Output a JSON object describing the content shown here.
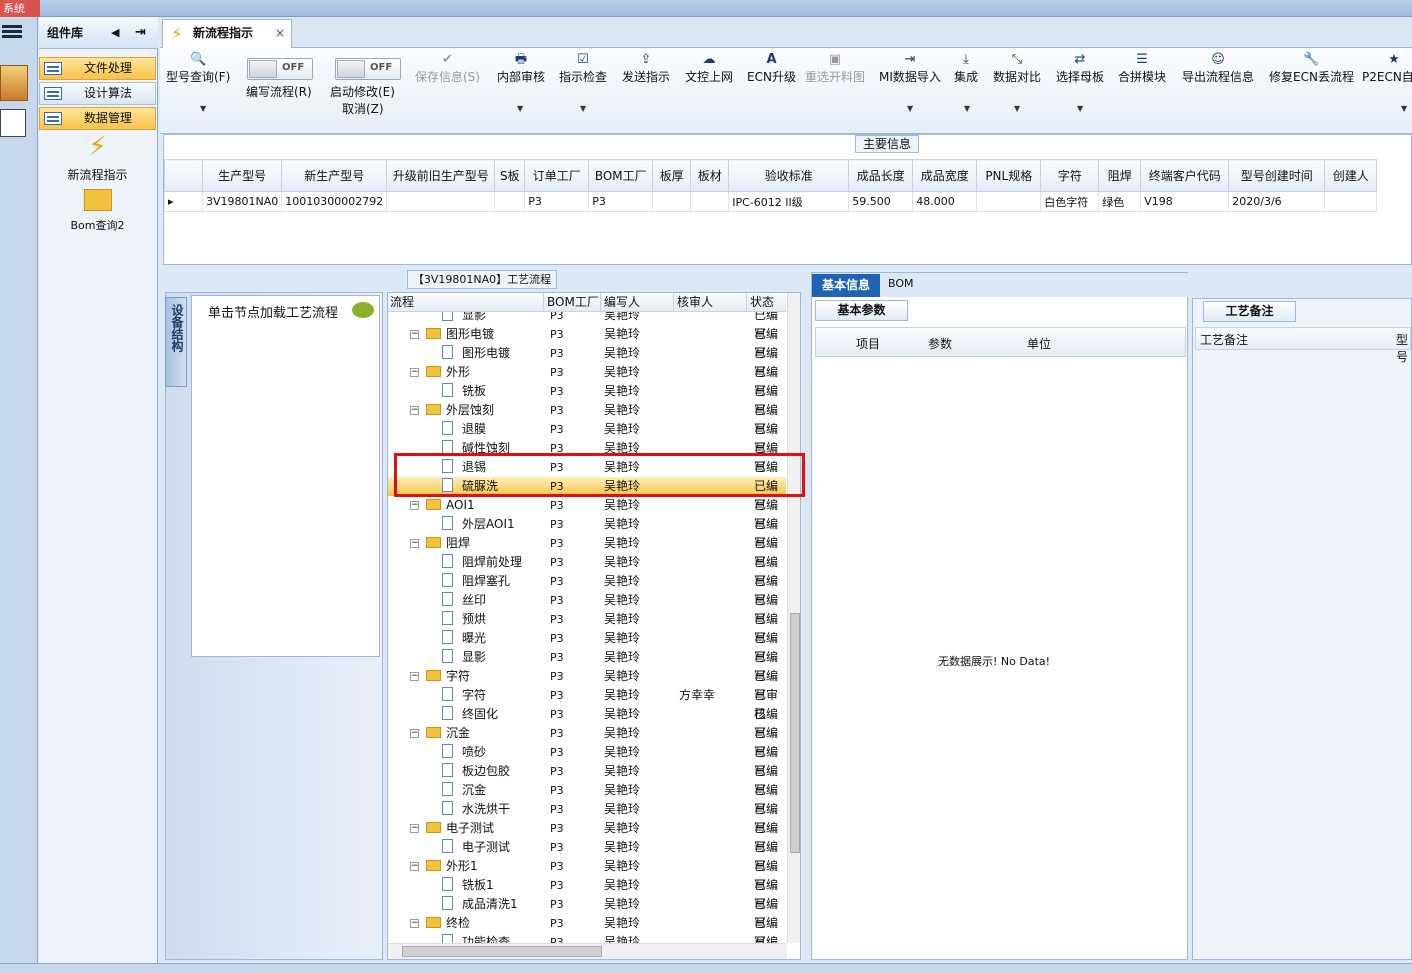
{
  "window": {
    "system_tab": "系统"
  },
  "components": {
    "header": "组件库",
    "nav": [
      {
        "label": "文件处理",
        "selected": true
      },
      {
        "label": "设计算法",
        "selected": false
      },
      {
        "label": "数据管理",
        "selected": true
      }
    ],
    "tools": [
      {
        "label": "新流程指示",
        "icon": "lightning-icon"
      },
      {
        "label": "Bom查询2",
        "icon": "folder-open-icon"
      }
    ]
  },
  "doc_tab": {
    "label": "新流程指示",
    "close": "×"
  },
  "ribbon": {
    "buttons": [
      {
        "label": "型号查询(F)",
        "icon": "search-icon",
        "glyph": "🔍",
        "disabled": false
      },
      {
        "label": "保存信息(S)",
        "icon": "check-icon",
        "glyph": "✔",
        "disabled": true
      },
      {
        "label": "内部审核",
        "icon": "printer-icon",
        "glyph": "🖶",
        "disabled": false
      },
      {
        "label": "指示检查",
        "icon": "checkbox-icon",
        "glyph": "☑",
        "disabled": false
      },
      {
        "label": "发送指示",
        "icon": "upload-icon",
        "glyph": "⇪",
        "disabled": false
      },
      {
        "label": "文控上网",
        "icon": "cloud-upload-icon",
        "glyph": "☁",
        "disabled": false
      },
      {
        "label": "ECN升级",
        "icon": "font-icon",
        "glyph": "A",
        "disabled": false
      },
      {
        "label": "重选开料图",
        "icon": "image-icon",
        "glyph": "▣",
        "disabled": true
      },
      {
        "label": "MI数据导入",
        "icon": "sign-in-icon",
        "glyph": "⇥",
        "disabled": false
      },
      {
        "label": "集成",
        "icon": "download-icon",
        "glyph": "⤓",
        "disabled": false
      },
      {
        "label": "数据对比",
        "icon": "compress-icon",
        "glyph": "⤡",
        "disabled": false
      },
      {
        "label": "选择母板",
        "icon": "random-icon",
        "glyph": "⇄",
        "disabled": false
      },
      {
        "label": "合拼模块",
        "icon": "list-icon",
        "glyph": "☰",
        "disabled": false
      },
      {
        "label": "导出流程信息",
        "icon": "smile-icon",
        "glyph": "☺",
        "disabled": false
      },
      {
        "label": "修复ECN丢流程",
        "icon": "wrench-icon",
        "glyph": "🔧",
        "disabled": false
      },
      {
        "label": "P2ECN自动",
        "icon": "star-icon",
        "glyph": "★",
        "disabled": false
      }
    ],
    "toggle1": {
      "state": "OFF",
      "label": "编写流程(R)"
    },
    "toggle2": {
      "state": "OFF",
      "label1": "启动修改(E)",
      "label2": "取消(Z)"
    }
  },
  "main_info": {
    "caption": "主要信息",
    "columns": [
      "生产型号",
      "新生产型号",
      "升级前旧生产型号",
      "S板",
      "订单工厂",
      "BOM工厂",
      "板厚",
      "板材",
      "验收标准",
      "成品长度",
      "成品宽度",
      "PNL规格",
      "字符",
      "阻焊",
      "终端客户代码",
      "型号创建时间",
      "创建人"
    ],
    "row": [
      "3V19801NA0",
      "10010300002792",
      "",
      "",
      "P3",
      "P3",
      "",
      "",
      "IPC-6012 II级",
      "59.500",
      "48.000",
      "",
      "白色字符",
      "绿色",
      "V198",
      "2020/3/6",
      ""
    ]
  },
  "process": {
    "title": "【3V19801NA0】工艺流程",
    "equipment_tab": "设备结构",
    "hint": "单击节点加载工艺流程",
    "columns": [
      "流程",
      "BOM工厂",
      "编写人",
      "核审人",
      "状态"
    ],
    "rows": [
      {
        "name": "显影",
        "type": "doc",
        "bom": "P3",
        "writer": "吴艳玲",
        "reviewer": "",
        "status": "已编写"
      },
      {
        "name": "图形电镀",
        "type": "folder",
        "bom": "P3",
        "writer": "吴艳玲",
        "reviewer": "",
        "status": "已编写"
      },
      {
        "name": "图形电镀",
        "type": "doc",
        "bom": "P3",
        "writer": "吴艳玲",
        "reviewer": "",
        "status": "已编写"
      },
      {
        "name": "外形",
        "type": "folder",
        "bom": "P3",
        "writer": "吴艳玲",
        "reviewer": "",
        "status": "已编写"
      },
      {
        "name": "铣板",
        "type": "doc",
        "bom": "P3",
        "writer": "吴艳玲",
        "reviewer": "",
        "status": "已编写"
      },
      {
        "name": "外层蚀刻",
        "type": "folder",
        "bom": "P3",
        "writer": "吴艳玲",
        "reviewer": "",
        "status": "已编写"
      },
      {
        "name": "退膜",
        "type": "doc",
        "bom": "P3",
        "writer": "吴艳玲",
        "reviewer": "",
        "status": "已编写"
      },
      {
        "name": "碱性蚀刻",
        "type": "doc",
        "bom": "P3",
        "writer": "吴艳玲",
        "reviewer": "",
        "status": "已编写"
      },
      {
        "name": "退锡",
        "type": "doc",
        "bom": "P3",
        "writer": "吴艳玲",
        "reviewer": "",
        "status": "已编写"
      },
      {
        "name": "硫脲洗",
        "type": "doc",
        "bom": "P3",
        "writer": "吴艳玲",
        "reviewer": "",
        "status": "已编写",
        "selected": true
      },
      {
        "name": "AOI1",
        "type": "folder",
        "bom": "P3",
        "writer": "吴艳玲",
        "reviewer": "",
        "status": "已编写"
      },
      {
        "name": "外层AOI1",
        "type": "doc",
        "bom": "P3",
        "writer": "吴艳玲",
        "reviewer": "",
        "status": "已编写"
      },
      {
        "name": "阻焊",
        "type": "folder",
        "bom": "P3",
        "writer": "吴艳玲",
        "reviewer": "",
        "status": "已编写"
      },
      {
        "name": "阻焊前处理",
        "type": "doc",
        "bom": "P3",
        "writer": "吴艳玲",
        "reviewer": "",
        "status": "已编写"
      },
      {
        "name": "阻焊塞孔",
        "type": "doc",
        "bom": "P3",
        "writer": "吴艳玲",
        "reviewer": "",
        "status": "已编写"
      },
      {
        "name": "丝印",
        "type": "doc",
        "bom": "P3",
        "writer": "吴艳玲",
        "reviewer": "",
        "status": "已编写"
      },
      {
        "name": "预烘",
        "type": "doc",
        "bom": "P3",
        "writer": "吴艳玲",
        "reviewer": "",
        "status": "已编写"
      },
      {
        "name": "曝光",
        "type": "doc",
        "bom": "P3",
        "writer": "吴艳玲",
        "reviewer": "",
        "status": "已编写"
      },
      {
        "name": "显影",
        "type": "doc",
        "bom": "P3",
        "writer": "吴艳玲",
        "reviewer": "",
        "status": "已编写"
      },
      {
        "name": "字符",
        "type": "folder",
        "bom": "P3",
        "writer": "吴艳玲",
        "reviewer": "",
        "status": "已编写"
      },
      {
        "name": "字符",
        "type": "doc",
        "bom": "P3",
        "writer": "吴艳玲",
        "reviewer": "方幸幸",
        "status": "已审核"
      },
      {
        "name": "终固化",
        "type": "doc",
        "bom": "P3",
        "writer": "吴艳玲",
        "reviewer": "",
        "status": "已编写"
      },
      {
        "name": "沉金",
        "type": "folder",
        "bom": "P3",
        "writer": "吴艳玲",
        "reviewer": "",
        "status": "已编写"
      },
      {
        "name": "喷砂",
        "type": "doc",
        "bom": "P3",
        "writer": "吴艳玲",
        "reviewer": "",
        "status": "已编写"
      },
      {
        "name": "板边包胶",
        "type": "doc",
        "bom": "P3",
        "writer": "吴艳玲",
        "reviewer": "",
        "status": "已编写"
      },
      {
        "name": "沉金",
        "type": "doc",
        "bom": "P3",
        "writer": "吴艳玲",
        "reviewer": "",
        "status": "已编写"
      },
      {
        "name": "水洗烘干",
        "type": "doc",
        "bom": "P3",
        "writer": "吴艳玲",
        "reviewer": "",
        "status": "已编写"
      },
      {
        "name": "电子测试",
        "type": "folder",
        "bom": "P3",
        "writer": "吴艳玲",
        "reviewer": "",
        "status": "已编写"
      },
      {
        "name": "电子测试",
        "type": "doc",
        "bom": "P3",
        "writer": "吴艳玲",
        "reviewer": "",
        "status": "已编写"
      },
      {
        "name": "外形1",
        "type": "folder",
        "bom": "P3",
        "writer": "吴艳玲",
        "reviewer": "",
        "status": "已编写"
      },
      {
        "name": "铣板1",
        "type": "doc",
        "bom": "P3",
        "writer": "吴艳玲",
        "reviewer": "",
        "status": "已编写"
      },
      {
        "name": "成品清洗1",
        "type": "doc",
        "bom": "P3",
        "writer": "吴艳玲",
        "reviewer": "",
        "status": "已编写"
      },
      {
        "name": "终检",
        "type": "folder",
        "bom": "P3",
        "writer": "吴艳玲",
        "reviewer": "",
        "status": "已编写"
      },
      {
        "name": "功能检查",
        "type": "doc",
        "bom": "P3",
        "writer": "吴艳玲",
        "reviewer": "",
        "status": "已编写"
      }
    ]
  },
  "info": {
    "tabs": [
      "基本信息",
      "BOM"
    ],
    "section": "基本参数",
    "columns": [
      "项目",
      "参数",
      "单位"
    ],
    "empty": "无数据展示! No Data!"
  },
  "remarks": {
    "title": "工艺备注",
    "column": "工艺备注",
    "column2": "型号"
  },
  "colors": {
    "accent": "#1f63b3",
    "highlight": "#f7c34a",
    "alert": "#e01010"
  }
}
